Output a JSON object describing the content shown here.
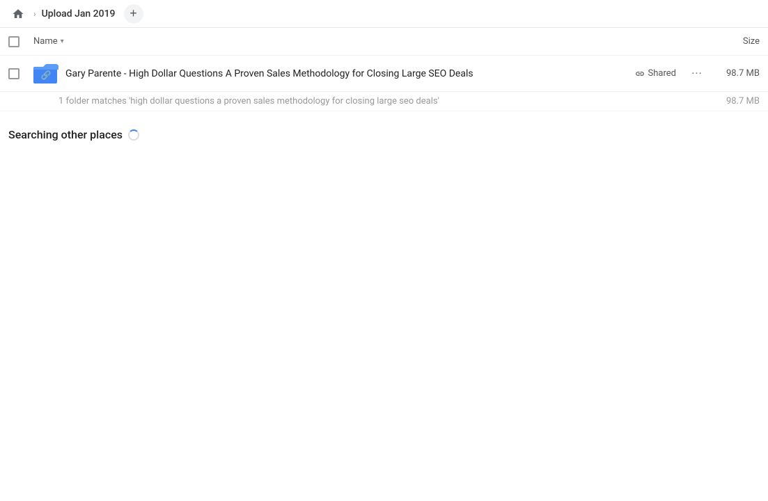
{
  "header": {
    "home_label": "Home",
    "breadcrumb_title": "Upload Jan 2019",
    "add_button_label": "+"
  },
  "columns": {
    "name_label": "Name",
    "size_label": "Size"
  },
  "file_row": {
    "name": "Gary Parente - High Dollar Questions A Proven Sales Methodology for Closing Large SEO Deals",
    "shared_label": "Shared",
    "size": "98.7 MB",
    "more_options_label": "···"
  },
  "match_info": {
    "text": "1 folder matches 'high dollar questions a proven sales methodology for closing large seo deals'",
    "size": "98.7 MB"
  },
  "searching_section": {
    "label": "Searching other places"
  },
  "icons": {
    "home": "🏠",
    "link": "🔗",
    "folder_link": "📁"
  }
}
